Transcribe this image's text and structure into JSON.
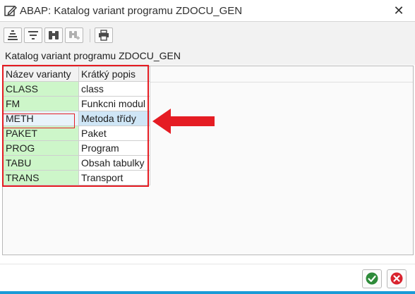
{
  "window": {
    "title": "ABAP: Katalog variant programu ZDOCU_GEN",
    "title_icon": "edit-pencil-icon",
    "close_icon": "close-icon"
  },
  "toolbar": {
    "buttons": [
      {
        "name": "sort-ascending-icon"
      },
      {
        "name": "filter-icon"
      },
      {
        "name": "find-binoculars-icon"
      },
      {
        "name": "find-next-icon"
      },
      {
        "name": "print-icon"
      }
    ]
  },
  "headline": "Katalog variant programu ZDOCU_GEN",
  "table": {
    "columns": [
      "Název varianty",
      "Krátký popis"
    ],
    "rows": [
      {
        "key": "CLASS",
        "text": "class"
      },
      {
        "key": "FM",
        "text": "Funkcni modul"
      },
      {
        "key": "METH",
        "text": "Metoda třídy"
      },
      {
        "key": "PAKET",
        "text": "Paket"
      },
      {
        "key": "PROG",
        "text": "Program"
      },
      {
        "key": "TABU",
        "text": "Obsah tabulky"
      },
      {
        "key": "TRANS",
        "text": "Transport"
      }
    ],
    "selected_row": 2
  },
  "footer": {
    "confirm_icon": "checkmark-icon",
    "cancel_icon": "cancel-icon"
  },
  "colors": {
    "key_cell": "#cdf6c9",
    "selected_cell": "#cfe6f6",
    "annotation": "#e51c23",
    "accent_line": "#1a9bd7"
  }
}
